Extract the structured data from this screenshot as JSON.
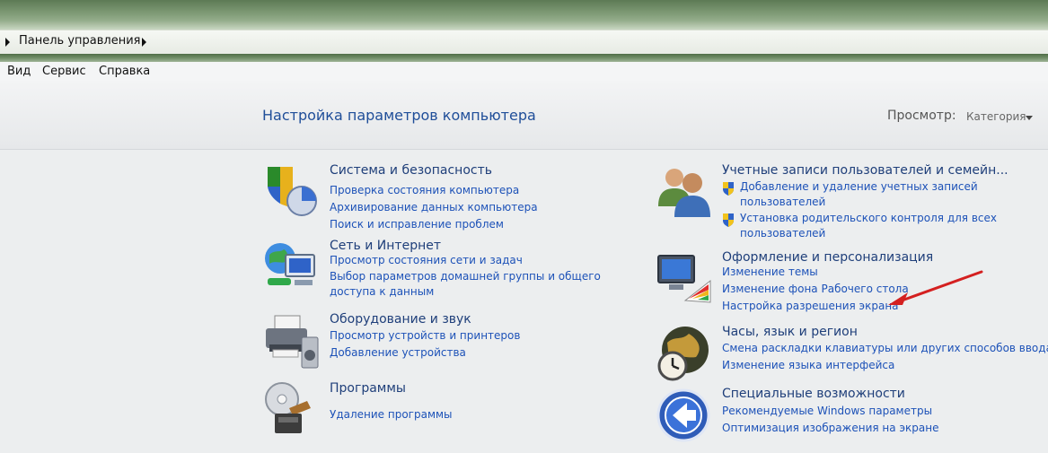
{
  "address_bar": {
    "breadcrumb": "Панель управления"
  },
  "menu": {
    "items": [
      "Вид",
      "Сервис",
      "Справка"
    ]
  },
  "header": {
    "title": "Настройка параметров компьютера",
    "view_label": "Просмотр:",
    "view_value": "Категория"
  },
  "categories": [
    {
      "title": "Система и безопасность",
      "icon": "shield-chart-icon",
      "links": [
        "Проверка состояния компьютера",
        "Архивирование данных компьютера",
        "Поиск и исправление проблем"
      ]
    },
    {
      "title": "Сеть и Интернет",
      "icon": "network-globe-icon",
      "links": [
        "Просмотр состояния сети и задач",
        "Выбор параметров домашней группы и общего доступа к данным"
      ]
    },
    {
      "title": "Оборудование и звук",
      "icon": "printer-speaker-icon",
      "links": [
        "Просмотр устройств и принтеров",
        "Добавление устройства"
      ]
    },
    {
      "title": "Программы",
      "icon": "disc-program-icon",
      "links": [
        "Удаление программы"
      ]
    },
    {
      "title": "Учетные записи пользователей и семейн...",
      "icon": "users-icon",
      "links": [
        "Добавление и удаление учетных записей пользователей",
        "Установка родительского контроля для всех пользователей"
      ]
    },
    {
      "title": "Оформление и персонализация",
      "icon": "monitor-palette-icon",
      "links": [
        "Изменение темы",
        "Изменение фона Рабочего стола",
        "Настройка разрешения экрана"
      ]
    },
    {
      "title": "Часы, язык и регион",
      "icon": "clock-globe-icon",
      "links": [
        "Смена раскладки клавиатуры или других способов ввода",
        "Изменение языка интерфейса"
      ]
    },
    {
      "title": "Специальные возможности",
      "icon": "accessibility-icon",
      "links": [
        "Рекомендуемые Windows параметры",
        "Оптимизация изображения на экране"
      ]
    }
  ],
  "colors": {
    "link": "#1d52b8",
    "title": "#1f3f7a",
    "header_title": "#1f4e99",
    "annotation_arrow": "#d42020"
  }
}
